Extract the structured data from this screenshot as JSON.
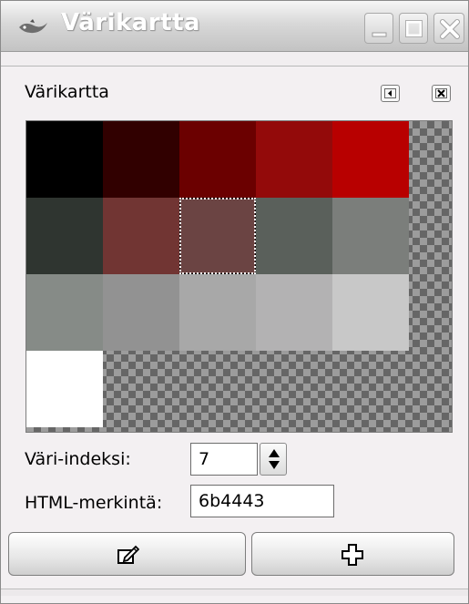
{
  "window": {
    "title": "Värikartta",
    "icons": {
      "app": "gimp-wilber-icon",
      "minimize": "minimize-icon",
      "maximize": "maximize-icon",
      "close": "close-icon"
    }
  },
  "dock": {
    "title": "Värikartta",
    "menu_icon": "tab-menu-arrow-icon",
    "close_icon": "close-tab-icon"
  },
  "colormap": {
    "selected_index": 7,
    "colors": [
      "#000000",
      "#310000",
      "#6b0000",
      "#930a0a",
      "#b80000",
      "#2f3530",
      "#713533",
      "#6b4443",
      "#5a605b",
      "#7b7e7b",
      "#868b87",
      "#929292",
      "#a8a8a8",
      "#b3b2b3",
      "#c8c8c8",
      "#ffffff"
    ],
    "transparent_color": "checkerboard"
  },
  "fields": {
    "index_label": "Väri-indeksi:",
    "index_value": "7",
    "html_label": "HTML-merkintä:",
    "html_value": "6b4443"
  },
  "buttons": {
    "edit_icon": "edit-color-icon",
    "add_icon": "add-color-icon"
  }
}
